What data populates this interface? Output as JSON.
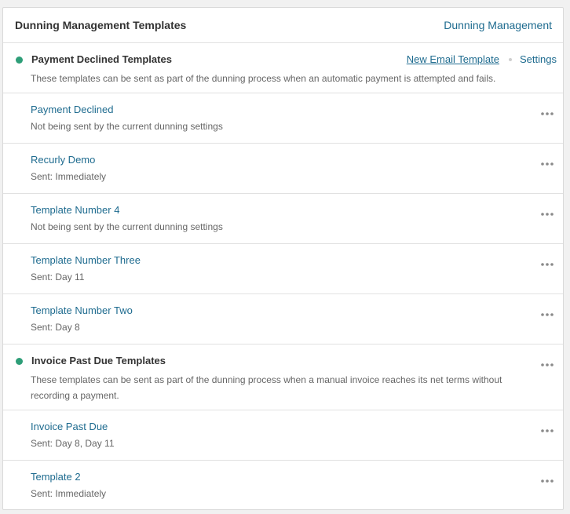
{
  "header": {
    "title": "Dunning Management Templates",
    "link_label": "Dunning Management"
  },
  "colors": {
    "status_active": "#2e9e78",
    "link": "#1e6b8f"
  },
  "groups": [
    {
      "title": "Payment Declined Templates",
      "description": "These templates can be sent as part of the dunning process when an automatic payment is attempted and fails.",
      "actions": {
        "new_template_label": "New Email Template",
        "settings_label": "Settings"
      },
      "templates": [
        {
          "name": "Payment Declined",
          "status": "Not being sent by the current dunning settings"
        },
        {
          "name": "Recurly Demo",
          "status": "Sent: Immediately"
        },
        {
          "name": "Template Number 4",
          "status": "Not being sent by the current dunning settings"
        },
        {
          "name": "Template Number Three",
          "status": "Sent: Day 11"
        },
        {
          "name": "Template Number Two",
          "status": "Sent: Day 8"
        }
      ]
    },
    {
      "title": "Invoice Past Due Templates",
      "description": "These templates can be sent as part of the dunning process when a manual invoice reaches its net terms without recording a payment.",
      "templates": [
        {
          "name": "Invoice Past Due",
          "status": "Sent: Day 8, Day 11"
        },
        {
          "name": "Template 2",
          "status": "Sent: Immediately"
        }
      ]
    }
  ],
  "icons": {
    "status": "status-dot-icon",
    "more": "more-horizontal-icon"
  }
}
